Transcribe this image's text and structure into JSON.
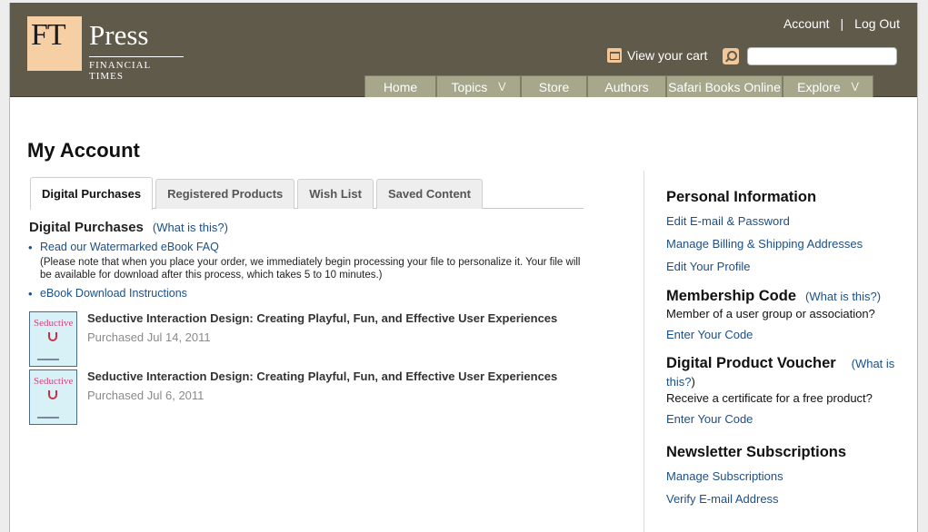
{
  "header": {
    "logo_ft": "FT",
    "logo_press": "Press",
    "logo_sub": "FINANCIAL TIMES",
    "account": "Account",
    "separator": "|",
    "logout": "Log Out",
    "cart": "View your cart",
    "search_placeholder": ""
  },
  "nav": [
    {
      "label": "Home",
      "chevron": false
    },
    {
      "label": "Topics",
      "chevron": true
    },
    {
      "label": "Store",
      "chevron": false
    },
    {
      "label": "Authors",
      "chevron": false
    },
    {
      "label": "Safari Books Online",
      "chevron": false
    },
    {
      "label": "Explore",
      "chevron": true
    }
  ],
  "main": {
    "title": "My Account",
    "tabs": [
      "Digital Purchases",
      "Registered Products",
      "Wish List",
      "Saved Content"
    ],
    "section_title": "Digital Purchases",
    "section_help": "(What is this?)",
    "faq_link": "Read our Watermarked eBook FAQ",
    "note": "(Please note that when you place your order, we immediately begin processing your file to personalize it. Your file will be available for download after this process, which takes 5 to 10 minutes.)",
    "download_link": "eBook Download Instructions",
    "products": [
      {
        "title": "Seductive Interaction Design: Creating Playful, Fun, and Effective User Experiences",
        "date": "Purchased Jul 14, 2011",
        "cover_text": "Seductive"
      },
      {
        "title": "Seductive Interaction Design: Creating Playful, Fun, and Effective User Experiences",
        "date": "Purchased Jul 6, 2011",
        "cover_text": "Seductive"
      }
    ]
  },
  "sidebar": {
    "personal_title": "Personal Information",
    "edit_email": "Edit E-mail & Password",
    "manage_billing": "Manage Billing & Shipping Addresses",
    "edit_profile": "Edit Your Profile",
    "membership_title": "Membership Code",
    "membership_help": "(What is this?)",
    "membership_text": "Member of a user group or association?",
    "membership_link": "Enter Your Code",
    "voucher_title": "Digital Product Voucher",
    "voucher_help_1": "(What is",
    "voucher_help_2": "this?",
    "voucher_help_3": ")",
    "voucher_text": "Receive a certificate for a free product?",
    "voucher_link": "Enter Your Code",
    "newsletter_title": "Newsletter Subscriptions",
    "manage_subs": "Manage Subscriptions",
    "verify_email": "Verify E-mail Address"
  },
  "colors": {
    "header_bg": "#5f5a49",
    "nav_bg": "#a6a78b",
    "logo_bg": "#f6cfa4",
    "link": "#1d4f87"
  }
}
